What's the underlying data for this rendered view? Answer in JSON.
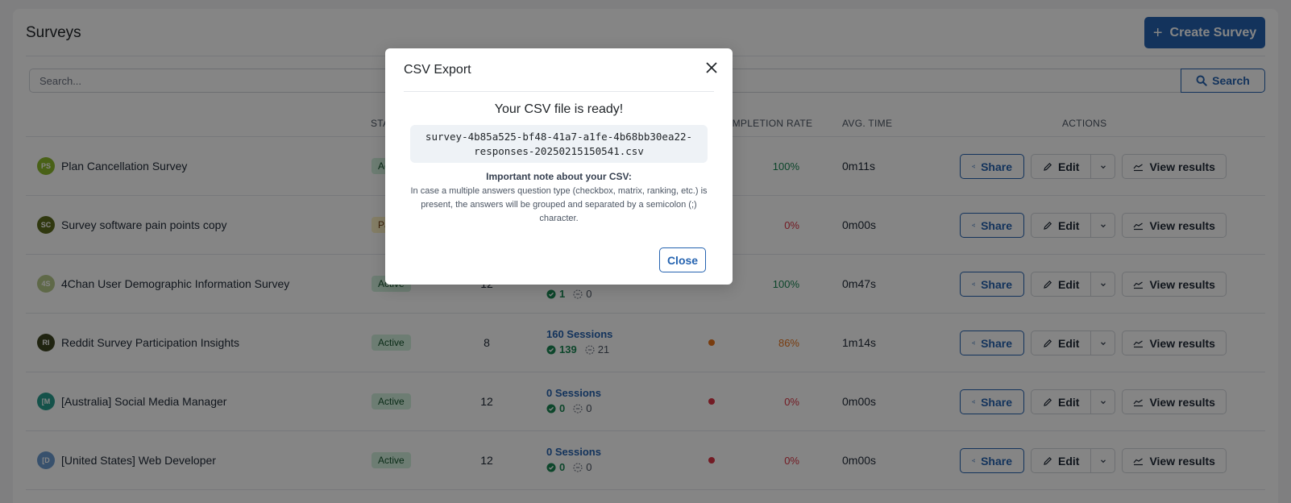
{
  "header": {
    "title": "Surveys",
    "create_button": "Create Survey"
  },
  "search": {
    "placeholder": "Search...",
    "value": "",
    "button": "Search"
  },
  "table": {
    "columns": [
      "",
      "STATUS",
      "",
      "",
      "",
      "COMPLETION RATE",
      "AVG. TIME",
      "ACTIONS"
    ],
    "column_labels": {
      "status": "STATUS",
      "completion_rate": "COMPLETION RATE",
      "avg_time": "AVG. TIME",
      "actions": "ACTIONS"
    },
    "action_labels": {
      "share": "Share",
      "edit": "Edit",
      "view_results": "View results"
    },
    "rows": [
      {
        "initials": "PS",
        "avatar_color": "#8dbb2d",
        "name": "Plan Cancellation Survey",
        "status": "Active",
        "questions": "",
        "sessions": "",
        "completed": "",
        "partial": "",
        "rate_dot_color": "",
        "completion_rate": "100%",
        "rate_color": "#198754",
        "avg_time": "0m11s"
      },
      {
        "initials": "SC",
        "avatar_color": "#5d6b1e",
        "name": "Survey software pain points copy",
        "status": "Paused",
        "questions": "",
        "sessions": "",
        "completed": "",
        "partial": "",
        "rate_dot_color": "",
        "completion_rate": "0%",
        "rate_color": "#dc3545",
        "avg_time": "0m00s"
      },
      {
        "initials": "4S",
        "avatar_color": "#b7c98a",
        "name": "4Chan User Demographic Information Survey",
        "status": "Active",
        "questions": "12",
        "sessions": "",
        "completed": "1",
        "partial": "0",
        "rate_dot_color": "",
        "completion_rate": "100%",
        "rate_color": "#198754",
        "avg_time": "0m47s"
      },
      {
        "initials": "RI",
        "avatar_color": "#3f4522",
        "name": "Reddit Survey Participation Insights",
        "status": "Active",
        "questions": "8",
        "sessions": "160 Sessions",
        "completed": "139",
        "partial": "21",
        "rate_dot_color": "#e8741c",
        "completion_rate": "86%",
        "rate_color": "#e8741c",
        "avg_time": "1m14s"
      },
      {
        "initials": "[M",
        "avatar_color": "#2a9d8f",
        "name": "[Australia] Social Media Manager",
        "status": "Active",
        "questions": "12",
        "sessions": "0 Sessions",
        "completed": "0",
        "partial": "0",
        "rate_dot_color": "#dc3545",
        "completion_rate": "0%",
        "rate_color": "#dc3545",
        "avg_time": "0m00s"
      },
      {
        "initials": "[D",
        "avatar_color": "#6b9bd1",
        "name": "[United States] Web Developer",
        "status": "Active",
        "questions": "12",
        "sessions": "0 Sessions",
        "completed": "0",
        "partial": "0",
        "rate_dot_color": "#dc3545",
        "completion_rate": "0%",
        "rate_color": "#dc3545",
        "avg_time": "0m00s"
      }
    ]
  },
  "modal": {
    "title": "CSV Export",
    "heading": "Your CSV file is ready!",
    "filename_line1": "survey-4b85a525-bf48-41a7-a1fe-4b68bb30ea22-",
    "filename_line2": "responses-20250215150541.csv",
    "note_title": "Important note about your CSV:",
    "note_body": "In case a multiple answers question type (checkbox, matrix, ranking, etc.) is present, the answers will be grouped and separated by a semicolon (;) character.",
    "close_button": "Close"
  },
  "colors": {
    "primary": "#2563b0",
    "success": "#198754",
    "warning": "#e8741c",
    "danger": "#dc3545"
  }
}
